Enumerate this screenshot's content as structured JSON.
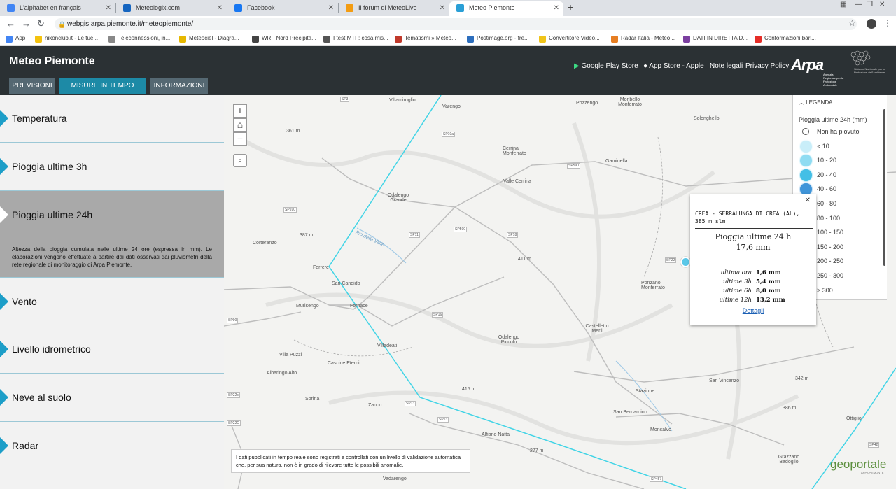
{
  "browser": {
    "tabs": [
      {
        "title": "L'alphabet en français",
        "color": "#4285f4"
      },
      {
        "title": "Meteologix.com",
        "color": "#1565c0"
      },
      {
        "title": "Facebook",
        "color": "#1877f2"
      },
      {
        "title": "Il forum di MeteoLive",
        "color": "#f39c12"
      },
      {
        "title": "Meteo Piemonte",
        "color": "#2a9fd6"
      }
    ],
    "url": "webgis.arpa.piemonte.it/meteopiemonte/",
    "bookmarks": [
      {
        "label": "App",
        "color": "#4285f4"
      },
      {
        "label": "nikonclub.it - Le tue...",
        "color": "#f4c20d"
      },
      {
        "label": "Teleconnessioni, in...",
        "color": "#888888"
      },
      {
        "label": "Meteociel - Diagra...",
        "color": "#e6b800"
      },
      {
        "label": "WRF Nord Precipita...",
        "color": "#444444"
      },
      {
        "label": "I test MTF: cosa mis...",
        "color": "#555555"
      },
      {
        "label": "Tematismi » Meteo...",
        "color": "#c0392b"
      },
      {
        "label": "Postimage.org - fre...",
        "color": "#2c6ebd"
      },
      {
        "label": "Convertitore Video...",
        "color": "#f0c419"
      },
      {
        "label": "Radar Italia - Meteo...",
        "color": "#e67e22"
      },
      {
        "label": "DATI IN DIRETTA D...",
        "color": "#7b3fa0"
      },
      {
        "label": "Conformazioni bari...",
        "color": "#e52d27"
      }
    ]
  },
  "header": {
    "title": "Meteo Piemonte",
    "tabs": [
      "PREVISIONI",
      "MISURE IN TEMPO REALE",
      "INFORMAZIONI"
    ],
    "links": [
      "Google Play Store",
      "App Store - Apple",
      "Note legali",
      "Privacy Policy"
    ],
    "logo": "Arpa",
    "logo_sub": "Agenzia Regionale per la Protezione Ambientale",
    "snpa_text": "Sistema Nazionale per la Protezione dell'Ambiente"
  },
  "sidebar": {
    "items": [
      "Temperatura",
      "Pioggia ultime 3h",
      "Pioggia ultime 24h",
      "Vento",
      "Livello idrometrico",
      "Neve al suolo",
      "Radar"
    ],
    "active_description": "Altezza della pioggia cumulata nelle ultime 24 ore (espressa in mm). Le elaborazioni vengono effettuate a partire dai dati osservati dai pluviometri della rete regionale di monitoraggio di Arpa Piemonte."
  },
  "map": {
    "places": [
      "Villamiroglio",
      "Varengo",
      "Pozzengo",
      "Monbello Monferrato",
      "Solonghello",
      "Cerrina Monferrato",
      "Gaminella",
      "Valle Cerrina",
      "Odalengo Grande",
      "Corteranzo",
      "Ferrere",
      "San Candido",
      "Murisengo",
      "Fornace",
      "Ponzano Monferrato",
      "Castelletto Merli",
      "Odalengo Piccolo",
      "Villadeati",
      "Villa Puzzi",
      "Cascine Eterni",
      "Albaringo Alto",
      "Sorina",
      "Zanco",
      "San Vincenzo",
      "Stazione",
      "San Bernardino",
      "Moncalvo",
      "Alfiano Natta",
      "Ottiglio",
      "Grazzano Badoglio",
      "Vadarengo",
      "Rio delle Valle"
    ],
    "elevations": [
      "361 m",
      "387 m",
      "411 m",
      "415 m",
      "277 m",
      "342 m",
      "386 m"
    ],
    "roads": [
      "SP3",
      "SP10a",
      "SP590",
      "SP11",
      "SP18",
      "SP590",
      "SP590",
      "SP16",
      "SP90",
      "SP22",
      "SP22c",
      "SP22C",
      "SP13",
      "SP13",
      "SP42",
      "SP457"
    ],
    "disclaimer": "I dati pubblicati in tempo reale sono registrati e controllati con un livello di validazione automatica che, per sua natura, non è in grado di rilevare tutte le possibili anomalie.",
    "geoportale": "geoportale",
    "geoportale_sub": "ARPA PIEMONTE"
  },
  "legend": {
    "header": "LEGENDA",
    "title": "Pioggia ultime 24h (mm)",
    "classes": [
      {
        "label": "Non ha piovuto",
        "color": "#ffffff"
      },
      {
        "label": "< 10",
        "color": "#c9eef9"
      },
      {
        "label": "10 - 20",
        "color": "#8fdcf2"
      },
      {
        "label": "20 - 40",
        "color": "#43bfe6"
      },
      {
        "label": "40 - 60",
        "color": "#3f95d9"
      },
      {
        "label": "60 - 80",
        "color": "#3b6fd0"
      },
      {
        "label": "80 - 100",
        "color": "#5a4fc8"
      },
      {
        "label": "100 - 150",
        "color": "#7e3fbf"
      },
      {
        "label": "150 - 200",
        "color": "#a63fb0"
      },
      {
        "label": "200 - 250",
        "color": "#c83f8f"
      },
      {
        "label": "250 - 300",
        "color": "#dc3f5f"
      },
      {
        "label": "> 300",
        "color": "#e23a2a"
      }
    ]
  },
  "popup": {
    "station": "CREA - SERRALUNGA DI CREA (AL), 385 m slm",
    "title": "Pioggia ultime 24 h",
    "value": "17,6 mm",
    "rows": [
      {
        "k": "ultima ora",
        "v": "1,6 mm"
      },
      {
        "k": "ultime 3h",
        "v": "5,4 mm"
      },
      {
        "k": "ultime 6h",
        "v": "8,0 mm"
      },
      {
        "k": "ultime 12h",
        "v": "13,2 mm"
      }
    ],
    "link": "Dettagli"
  }
}
